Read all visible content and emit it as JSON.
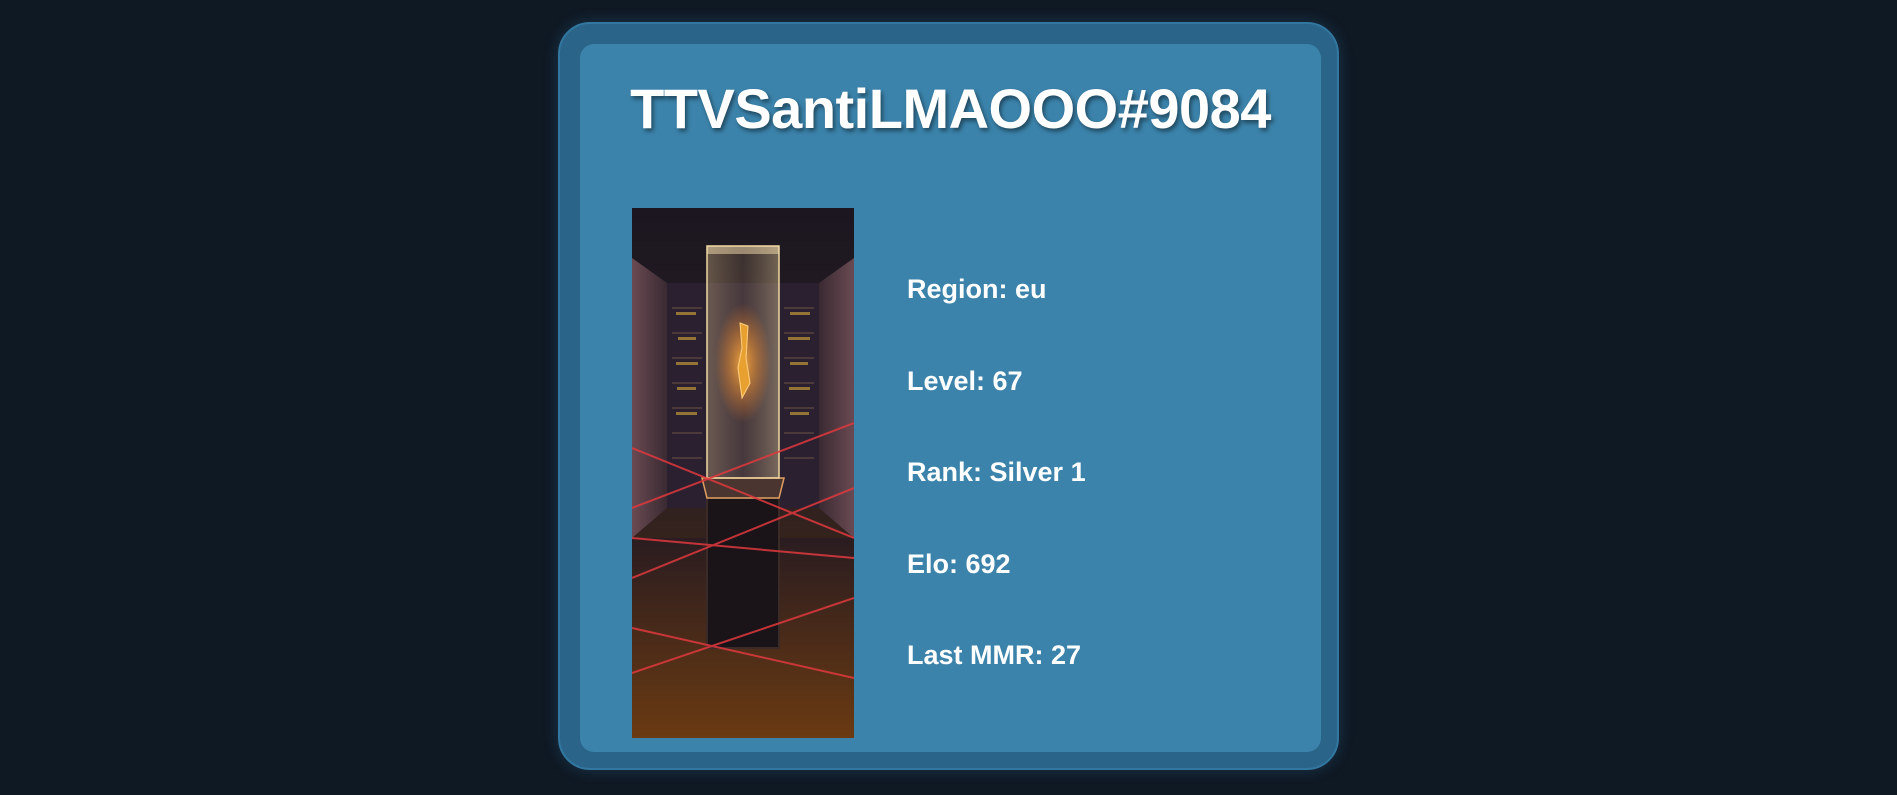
{
  "player": {
    "name": "TTVSantiLMAOOO#9084",
    "card_image": "vault-display-case-card-art"
  },
  "stats": {
    "region": "Region: eu",
    "level": "Level: 67",
    "rank": "Rank: Silver 1",
    "elo": "Elo: 692",
    "last_mmr": "Last MMR: 27"
  },
  "colors": {
    "page_background": "#0f1924",
    "outer_card": "#2a6488",
    "inner_card": "#3b83ab",
    "text": "#ffffff",
    "laser": "#e0393e"
  }
}
